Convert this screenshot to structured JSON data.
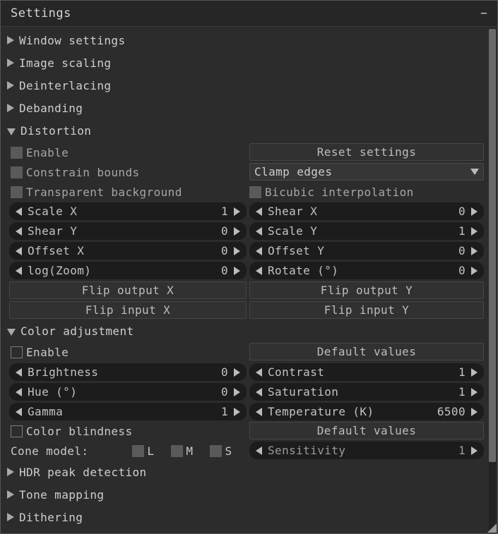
{
  "window": {
    "title": "Settings",
    "collapse_label": "−",
    "colors": {
      "window_bg": "#2c2c2c",
      "titlebar_bg": "#262626",
      "text": "#cfcfcf",
      "slider_bg": "#1c1c1c",
      "button_bg": "#313131",
      "combo_bg": "#363636",
      "checkbox_disabled": "#5a5a5a",
      "scrollbar_thumb": "#6b6b6b"
    }
  },
  "tree_nodes": [
    {
      "label": "Window settings",
      "state": "collapsed",
      "icon": "triangle-right-icon"
    },
    {
      "label": "Image scaling",
      "state": "collapsed",
      "icon": "triangle-right-icon"
    },
    {
      "label": "Deinterlacing",
      "state": "collapsed",
      "icon": "triangle-right-icon"
    },
    {
      "label": "Debanding",
      "state": "collapsed",
      "icon": "triangle-right-icon"
    },
    {
      "label": "Distortion",
      "state": "expanded",
      "icon": "triangle-down-icon"
    },
    {
      "label": "Color adjustment",
      "state": "expanded",
      "icon": "triangle-down-icon"
    },
    {
      "label": "HDR peak detection",
      "state": "collapsed",
      "icon": "triangle-right-icon"
    },
    {
      "label": "Tone mapping",
      "state": "collapsed",
      "icon": "triangle-right-icon"
    },
    {
      "label": "Dithering",
      "state": "collapsed",
      "icon": "triangle-right-icon"
    }
  ],
  "distortion": {
    "checkboxes": [
      {
        "label": "Enable",
        "checked": false,
        "style": "disabled"
      },
      {
        "label": "Constrain bounds",
        "checked": false,
        "style": "disabled"
      },
      {
        "label": "Transparent background",
        "checked": false,
        "style": "disabled"
      },
      {
        "label": "Bicubic interpolation",
        "checked": false,
        "style": "disabled"
      }
    ],
    "reset_button": "Reset settings",
    "combo": {
      "value": "Clamp edges",
      "arrow_icon": "chevron-down-icon"
    },
    "sliders_left": [
      {
        "label": "Scale X",
        "value": "1"
      },
      {
        "label": "Shear Y",
        "value": "0"
      },
      {
        "label": "Offset X",
        "value": "0"
      },
      {
        "label": "log(Zoom)",
        "value": "0"
      }
    ],
    "sliders_right": [
      {
        "label": "Shear X",
        "value": "0"
      },
      {
        "label": "Scale Y",
        "value": "1"
      },
      {
        "label": "Offset Y",
        "value": "0"
      },
      {
        "label": "Rotate (°)",
        "value": "0"
      }
    ],
    "flip_buttons": [
      "Flip output X",
      "Flip output Y",
      "Flip input X",
      "Flip input Y"
    ]
  },
  "color_adjustment": {
    "enable": {
      "label": "Enable",
      "checked": false,
      "style": "enabled"
    },
    "default_values_button": "Default values",
    "sliders_left": [
      {
        "label": "Brightness",
        "value": "0"
      },
      {
        "label": "Hue (°)",
        "value": "0"
      },
      {
        "label": "Gamma",
        "value": "1"
      }
    ],
    "sliders_right": [
      {
        "label": "Contrast",
        "value": "1"
      },
      {
        "label": "Saturation",
        "value": "1"
      },
      {
        "label": "Temperature (K)",
        "value": "6500"
      }
    ]
  },
  "color_blindness": {
    "enable": {
      "label": "Color blindness",
      "checked": false,
      "style": "enabled"
    },
    "default_values_button": "Default values",
    "cone_model_label": "Cone model:",
    "cones": [
      {
        "label": "L",
        "checked": false,
        "style": "disabled"
      },
      {
        "label": "M",
        "checked": false,
        "style": "disabled"
      },
      {
        "label": "S",
        "checked": false,
        "style": "disabled"
      }
    ],
    "sensitivity": {
      "label": "Sensitivity",
      "value": "1"
    }
  },
  "scrollbar": {
    "orientation": "vertical"
  }
}
